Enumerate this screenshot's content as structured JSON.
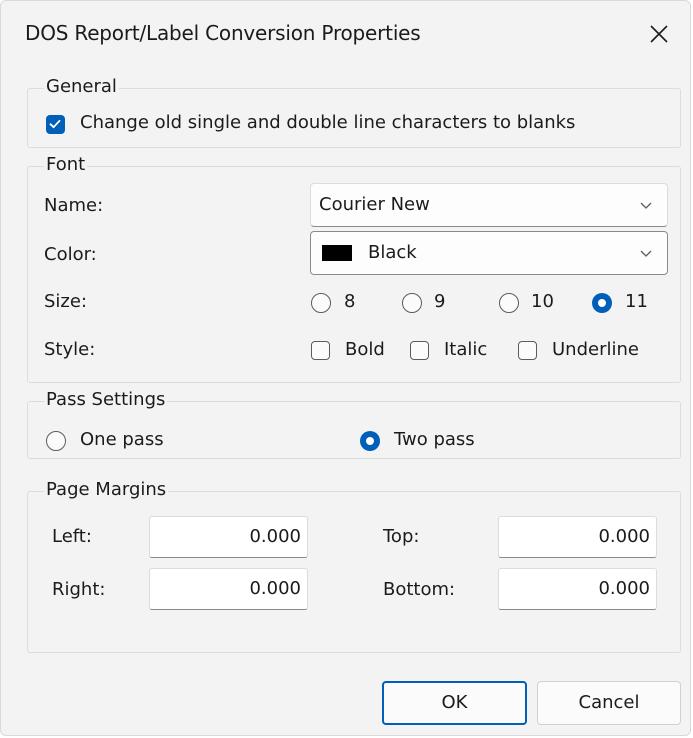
{
  "window": {
    "title": "DOS Report/Label Conversion Properties"
  },
  "general": {
    "legend": "General",
    "blank_lines_checkbox": {
      "label": "Change old single and double line characters to blanks",
      "checked": true
    }
  },
  "font": {
    "legend": "Font",
    "name_label": "Name:",
    "name_value": "Courier New",
    "color_label": "Color:",
    "color_value": "Black",
    "color_swatch": "#000000",
    "size_label": "Size:",
    "sizes": [
      {
        "label": "8",
        "checked": false
      },
      {
        "label": "9",
        "checked": false
      },
      {
        "label": "10",
        "checked": false
      },
      {
        "label": "11",
        "checked": true
      }
    ],
    "style_label": "Style:",
    "styles": [
      {
        "label": "Bold",
        "checked": false
      },
      {
        "label": "Italic",
        "checked": false
      },
      {
        "label": "Underline",
        "checked": false
      }
    ]
  },
  "pass_settings": {
    "legend": "Pass Settings",
    "options": [
      {
        "label": "One pass",
        "checked": false
      },
      {
        "label": "Two pass",
        "checked": true
      }
    ]
  },
  "page_margins": {
    "legend": "Page Margins",
    "left_label": "Left:",
    "left_value": "0.000",
    "top_label": "Top:",
    "top_value": "0.000",
    "right_label": "Right:",
    "right_value": "0.000",
    "bottom_label": "Bottom:",
    "bottom_value": "0.000"
  },
  "buttons": {
    "ok": "OK",
    "cancel": "Cancel"
  },
  "colors": {
    "accent": "#005fb8",
    "background": "#f3f3f3"
  },
  "icons": {
    "close": "close-icon",
    "dropdown": "chevron-down-icon",
    "checkmark": "checkmark-icon"
  }
}
